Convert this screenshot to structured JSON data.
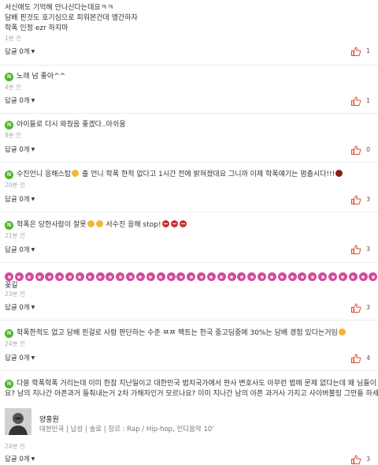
{
  "first_comment": {
    "lines": [
      "서신애도 기억해 안나신다는데요ㅋㅋ",
      "담배 핀것도 호기심으로 피워본건데 엥간하자",
      "학폭 인정 ezr 하지마"
    ],
    "time": "1분 전",
    "reply": "답글 0개",
    "likes": "1"
  },
  "comments": [
    {
      "text": "노래 넘 좋아^^",
      "time": "4분 전",
      "reply": "답글 0개",
      "likes": "1"
    },
    {
      "text": "아이들로 다시 와줬음 좋겠다..아쉬움",
      "time": "8분 전",
      "reply": "답글 0개",
      "likes": "0"
    },
    {
      "text": "수진언니 응해스탑",
      "text2": "출 언니 학폭 한적 없다고 1시간 전에 밝혀졌대요 그니까 이제 학폭얘기는 멈춥시다!!!",
      "time": "20분 전",
      "reply": "답글 0개",
      "likes": "3"
    },
    {
      "text": "학폭은 당한사람이 잘못",
      "text2": "서수진 응해 stop!",
      "time": "21분 전",
      "reply": "답글 0개",
      "likes": "3"
    },
    {
      "text": "학폭한적도 없고 담배 핀걸로 사람 판단하는 수준 ㅉㅉ 팩트는 한국 중고딩중에 30%는 담배 경험 있다는거임",
      "time": "24분 전",
      "reply": "답글 0개",
      "likes": "4"
    }
  ],
  "flower_comment": {
    "time": "23분 전",
    "reply": "답글 0개",
    "likes": "3",
    "tail": "꽃길"
  },
  "long_comment": {
    "line1": "다쓸 학폭학폭 거리는데 이미 한참 지난일이고 대한민국 법치국가에서 판사 변호사도 아무런 법에 문제 없다는데 왜 님들이",
    "line2": "요? 남의 지나간 아픈과거 들춰내는거 2차 가해자인거 모르나요? 이미 지나간 남의 아픈 과거사 가지고 사이버불링 그만들 하세"
  },
  "profile": {
    "name": "양홍원",
    "info": "대한민국 | 남성 | 솔로 | 장르 : Rap / Hip-hop, 인디음악 10'",
    "time": "24분 전",
    "reply": "답글 0개",
    "likes": "3"
  },
  "badge": "N",
  "colors": {
    "badge": "#4cb62a",
    "thumb_up": "#e04a2f",
    "muted": "#aaaaaa",
    "flower": "#d24b9c"
  }
}
